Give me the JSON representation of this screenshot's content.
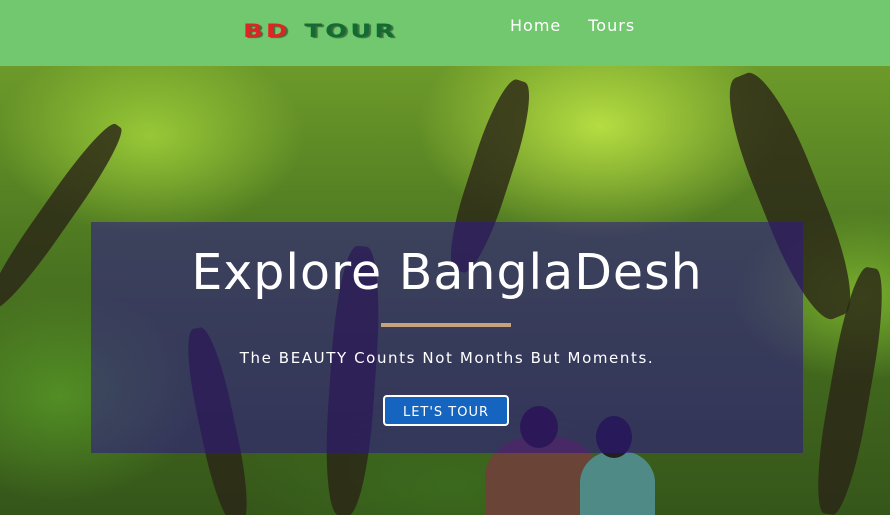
{
  "brand": {
    "part1": "BD",
    "part2": "TOUR"
  },
  "nav": {
    "home": "Home",
    "tours": "Tours"
  },
  "hero": {
    "headline": "Explore BanglaDesh",
    "tagline": "The BEAUTY Counts Not Months But Moments.",
    "cta": "LET'S TOUR"
  },
  "colors": {
    "navbar": "#72c86e",
    "logo_red": "#e02424",
    "logo_green": "#146b32",
    "overlay": "#2d148c",
    "divider": "#c6a27d",
    "button": "#1565c0"
  }
}
